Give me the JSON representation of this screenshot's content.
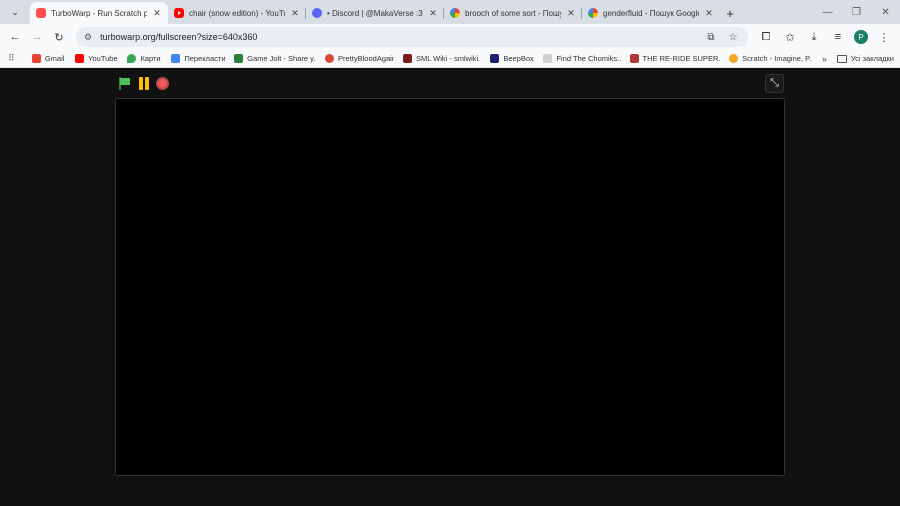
{
  "tabs": [
    {
      "label": "TurboWarp - Run Scratch projects faster",
      "favicon": "turbowarp-icon",
      "active": true
    },
    {
      "label": "chair (snow edition) - YouTube",
      "favicon": "youtube-icon",
      "active": false
    },
    {
      "label": "• Discord | @MakaVerse :3",
      "favicon": "discord-icon",
      "active": false
    },
    {
      "label": "brooch of some sort - Пошук Google",
      "favicon": "google-icon",
      "active": false
    },
    {
      "label": "genderfluid - Пошук Google",
      "favicon": "google-icon",
      "active": false
    }
  ],
  "toolbar": {
    "url": "turbowarp.org/fullscreen?size=640x360",
    "profile_initial": "P"
  },
  "bookmarks": {
    "items": [
      {
        "label": "Gmail",
        "color": "#ea4335"
      },
      {
        "label": "YouTube",
        "color": "#ff0000"
      },
      {
        "label": "Карти",
        "color": "#34a853"
      },
      {
        "label": "Перекласти",
        "color": "#4285f4"
      },
      {
        "label": "Game Jolt - Share y...",
        "color": "#2f7f3a"
      },
      {
        "label": "PrettyBloodAgain",
        "color": "#d9483b"
      },
      {
        "label": "SML Wiki - smlwiki...",
        "color": "#7a1d1d"
      },
      {
        "label": "BeepBox",
        "color": "#1f1f6e"
      },
      {
        "label": "Find The Chomiks...",
        "color": "#cfcfcf"
      },
      {
        "label": "THE RE-RIDE SUPER...",
        "color": "#b03a3a"
      },
      {
        "label": "Scratch - Imagine, P...",
        "color": "#f5a623"
      }
    ],
    "folder_label": "Усі закладки"
  },
  "player": {
    "stage_color": "#000000",
    "accent_colors": {
      "flag": "#4cbf56",
      "pause": "#ffbf00",
      "stop": "#ec5959"
    }
  }
}
